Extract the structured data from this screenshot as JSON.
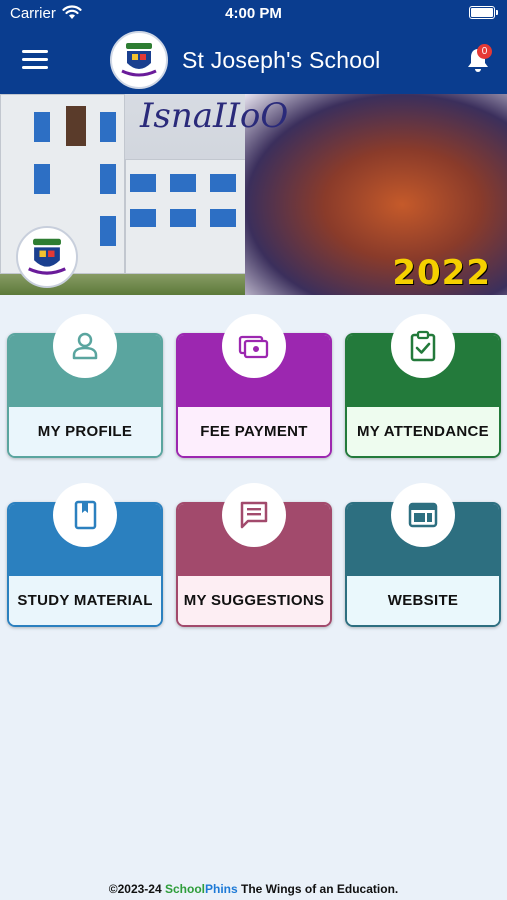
{
  "status_bar": {
    "carrier": "Carrier",
    "time": "4:00 PM"
  },
  "header": {
    "title": "St Joseph's School",
    "notification_count": "0"
  },
  "banner": {
    "year": "2022",
    "script_text": "IsnaIIoO"
  },
  "tiles": [
    {
      "label": "MY PROFILE",
      "icon": "person-icon",
      "top_color": "#5aa59f",
      "border_color": "#5aa59f",
      "bottom_bg": "#eaf6fc"
    },
    {
      "label": "FEE PAYMENT",
      "icon": "payment-icon",
      "top_color": "#9c27b0",
      "border_color": "#9c27b0",
      "bottom_bg": "#fdeefd"
    },
    {
      "label": "MY ATTENDANCE",
      "icon": "clipboard-check-icon",
      "top_color": "#237a3b",
      "border_color": "#237a3b",
      "bottom_bg": "#eefcef"
    },
    {
      "label": "STUDY MATERIAL",
      "icon": "book-icon",
      "top_color": "#2b80bf",
      "border_color": "#2b80bf",
      "bottom_bg": "#eaf6fc"
    },
    {
      "label": "MY SUGGESTIONS",
      "icon": "chat-icon",
      "top_color": "#a24a6c",
      "border_color": "#a24a6c",
      "bottom_bg": "#fdeef3"
    },
    {
      "label": "WEBSITE",
      "icon": "browser-icon",
      "top_color": "#2d6f80",
      "border_color": "#2d6f80",
      "bottom_bg": "#eaf8fc"
    }
  ],
  "footer": {
    "prefix": "©2023-24 ",
    "brand_a": "School",
    "brand_b": "Phins",
    "suffix": " The Wings of an Education."
  }
}
